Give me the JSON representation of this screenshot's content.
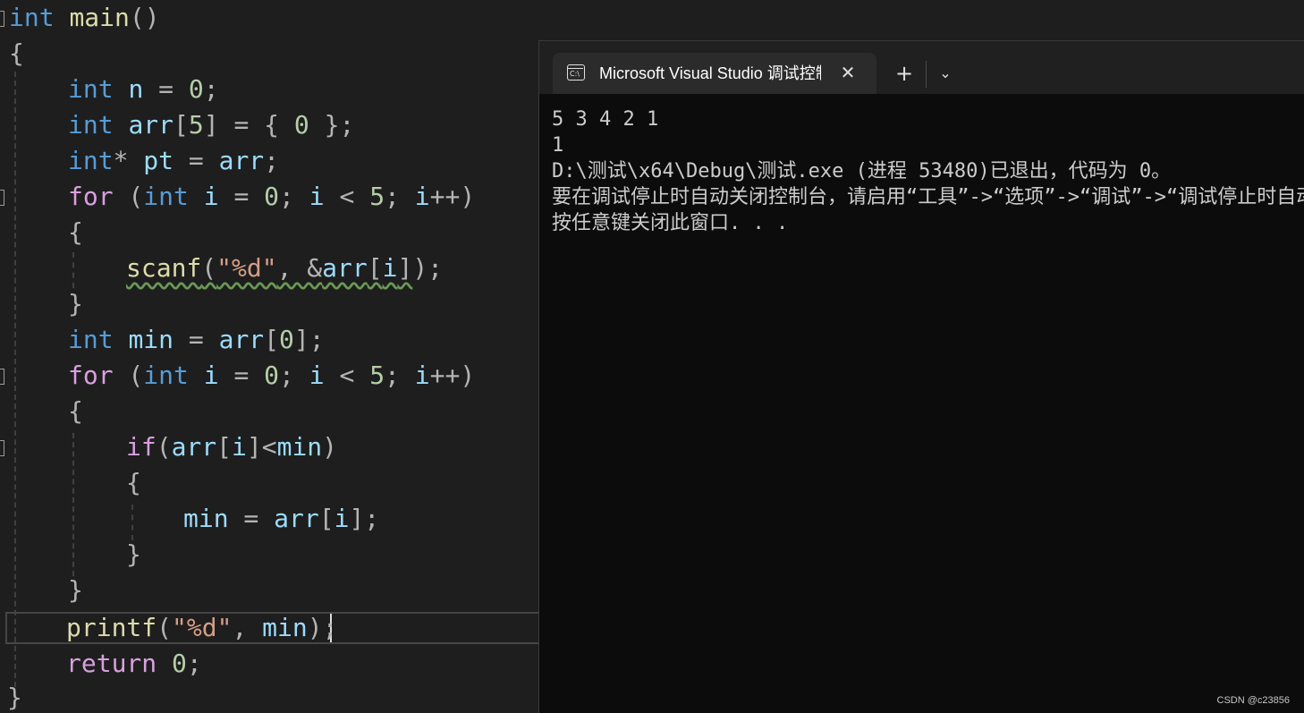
{
  "editor": {
    "lines": {
      "l1": {
        "kw": "int",
        "fn": "main",
        "pun": "()"
      },
      "l2": {
        "brace": "{"
      },
      "l3": {
        "kw": "int",
        "var": "n",
        "eq": " = ",
        "num": "0",
        "end": ";"
      },
      "l4": {
        "kw": "int",
        "var": "arr",
        "b1": "[",
        "num1": "5",
        "b2": "]",
        "eq": " = { ",
        "num2": "0",
        "end": " };"
      },
      "l5": {
        "kw": "int",
        "star": "* ",
        "var1": "pt",
        "eq": " = ",
        "var2": "arr",
        "end": ";"
      },
      "l6": {
        "ctl": "for",
        "p1": " (",
        "kw": "int",
        "sp": " ",
        "var1": "i",
        "eq": " = ",
        "num1": "0",
        "semi1": "; ",
        "var2": "i",
        "lt": " < ",
        "num2": "5",
        "semi2": "; ",
        "var3": "i",
        "inc": "++)"
      },
      "l7": {
        "brace": "{"
      },
      "l8": {
        "fn": "scanf",
        "p1": "(",
        "str": "\"%d\"",
        "comma": ", &",
        "var1": "arr",
        "b1": "[",
        "var2": "i",
        "b2": "]",
        "end": ");"
      },
      "l9": {
        "brace": "}"
      },
      "l10": {
        "kw": "int",
        "var1": "min",
        "eq": " = ",
        "var2": "arr",
        "b1": "[",
        "num": "0",
        "end": "];"
      },
      "l11": {
        "ctl": "for",
        "p1": " (",
        "kw": "int",
        "sp": " ",
        "var1": "i",
        "eq": " = ",
        "num1": "0",
        "semi1": "; ",
        "var2": "i",
        "lt": " < ",
        "num2": "5",
        "semi2": "; ",
        "var3": "i",
        "inc": "++)"
      },
      "l12": {
        "brace": "{"
      },
      "l13": {
        "ctl": "if",
        "p1": "(",
        "var1": "arr",
        "b1": "[",
        "var2": "i",
        "b2": "]<",
        "var3": "min",
        "end": ")"
      },
      "l14": {
        "brace": "{"
      },
      "l15": {
        "var1": "min",
        "eq": " = ",
        "var2": "arr",
        "b1": "[",
        "var3": "i",
        "end": "];"
      },
      "l16": {
        "brace": "}"
      },
      "l17": {
        "brace": "}"
      },
      "l18": {
        "fn": "printf",
        "p1": "(",
        "str": "\"%d\"",
        "comma": ", ",
        "var": "min",
        "end": ");"
      },
      "l19": {
        "ctl": "return",
        "sp": " ",
        "num": "0",
        "end": ";"
      },
      "l20": {
        "brace": "}"
      }
    }
  },
  "terminal": {
    "tab_title": "Microsoft Visual Studio 调试控制台",
    "tab_icon_text": "C:\\",
    "close_glyph": "✕",
    "new_tab_glyph": "+",
    "dropdown_glyph": "⌄",
    "output": [
      "5 3 4 2 1",
      "1",
      "D:\\测试\\x64\\Debug\\测试.exe (进程 53480)已退出，代码为 0。",
      "要在调试停止时自动关闭控制台，请启用“工具”->“选项”->“调试”->“调试停止时自动关闭控制台”。",
      "按任意键关闭此窗口. . ."
    ]
  },
  "watermark": "CSDN @c23856",
  "colors": {
    "keyword": "#569cd6",
    "control": "#d8a0df",
    "function": "#dcdcaa",
    "variable": "#9cdcfe",
    "number": "#b5cea8",
    "string": "#d69d85"
  }
}
